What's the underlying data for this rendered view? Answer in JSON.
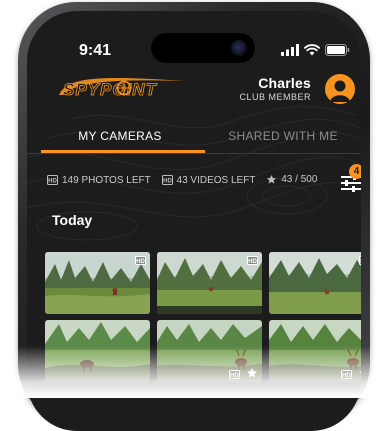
{
  "status_bar": {
    "time": "9:41",
    "icons": [
      "signal-icon",
      "wifi-icon",
      "battery-icon"
    ]
  },
  "header": {
    "brand": "SPYPOINT",
    "user_name": "Charles",
    "user_tier": "CLUB MEMBER",
    "avatar_icon": "user-avatar-icon"
  },
  "tabs": {
    "items": [
      {
        "label": "MY CAMERAS",
        "active": true
      },
      {
        "label": "SHARED WITH ME",
        "active": false
      }
    ]
  },
  "quota": {
    "photos": "149 PHOTOS LEFT",
    "videos": "43 VIDEOS LEFT",
    "favorites": "43 / 500"
  },
  "filter": {
    "icon": "filter-sliders-icon",
    "badge_count": "4"
  },
  "section": {
    "title": "Today"
  },
  "photos": [
    {
      "hd": true,
      "favorite": false
    },
    {
      "hd": true,
      "favorite": false
    },
    {
      "hd": true,
      "favorite": false
    },
    {
      "hd": false,
      "favorite": false
    },
    {
      "hd": true,
      "favorite": true
    },
    {
      "hd": true,
      "favorite": true
    }
  ],
  "colors": {
    "accent": "#f7931e",
    "background": "#1c1c1c",
    "tab_inactive": "#8c8c8c"
  }
}
